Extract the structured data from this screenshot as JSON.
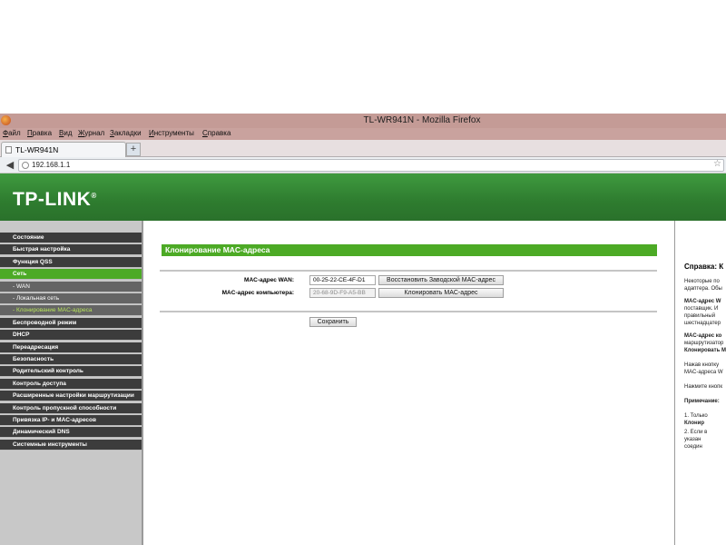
{
  "browser": {
    "window_title": "TL-WR941N - Mozilla Firefox",
    "menu": [
      "Файл",
      "Правка",
      "Вид",
      "Журнал",
      "Закладки",
      "Инструменты",
      "Справка"
    ],
    "tab_label": "TL-WR941N",
    "new_tab": "+",
    "url": "192.168.1.1"
  },
  "router": {
    "logo": "TP-LINK",
    "nav": [
      {
        "label": "Состояние",
        "state": "normal"
      },
      {
        "label": "Быстрая настройка",
        "state": "normal"
      },
      {
        "label": "Функция QSS",
        "state": "normal"
      },
      {
        "label": "Сеть",
        "state": "active"
      },
      {
        "label": "- WAN",
        "state": "sub"
      },
      {
        "label": "- Локальная сеть",
        "state": "sub"
      },
      {
        "label": "- Клонирование MAC-адреса",
        "state": "sub-active"
      },
      {
        "label": "Беспроводной режим",
        "state": "normal"
      },
      {
        "label": "DHCP",
        "state": "normal"
      },
      {
        "label": "Переадресация",
        "state": "normal"
      },
      {
        "label": "Безопасность",
        "state": "normal"
      },
      {
        "label": "Родительский контроль",
        "state": "normal"
      },
      {
        "label": "Контроль доступа",
        "state": "normal"
      },
      {
        "label": "Расширенные настройки маршрутизации",
        "state": "normal"
      },
      {
        "label": "Контроль пропускной способности",
        "state": "normal"
      },
      {
        "label": "Привязка IP- и MAC-адресов",
        "state": "normal"
      },
      {
        "label": "Динамический DNS",
        "state": "normal"
      },
      {
        "label": "Системные инструменты",
        "state": "normal"
      }
    ],
    "main": {
      "title": "Клонирование MAC-адреса",
      "wan_label": "MAC-адрес WAN:",
      "wan_value": "00-25-22-CE-4F-D1",
      "restore_button": "Восстановить Заводской MAC-адрес",
      "pc_label": "MAC-адрес компьютера:",
      "pc_value": "20-68-9D-F9-A5-BB",
      "clone_button": "Клонировать MAC-адрес",
      "save_button": "Сохранить"
    },
    "help": {
      "title": "Справка: К",
      "lines": [
        {
          "text": "Некоторые по",
          "bold": false
        },
        {
          "text": "адаптера. Обы",
          "bold": false
        },
        {
          "text": "MAC-адрес W",
          "bold": true
        },
        {
          "text": "поставщик. И",
          "bold": false
        },
        {
          "text": "правильный",
          "bold": false
        },
        {
          "text": "шестнадцатер",
          "bold": false
        },
        {
          "text": "MAC-адрес ко",
          "bold": true
        },
        {
          "text": "маршрутизатор",
          "bold": false
        },
        {
          "text": "Клонировать M",
          "bold": true
        },
        {
          "text": "Нажав кнопку",
          "bold": false
        },
        {
          "text": "MAC-адреса W",
          "bold": false
        },
        {
          "text": "Нажмите кнопк",
          "bold": false
        },
        {
          "text": "Примечание:",
          "bold": true
        },
        {
          "text": "1.  Только",
          "bold": false
        },
        {
          "text": "      Клонир",
          "bold": true
        },
        {
          "text": "2.  Если в",
          "bold": false
        },
        {
          "text": "      указан",
          "bold": false
        },
        {
          "text": "      соедин",
          "bold": false
        }
      ]
    }
  }
}
